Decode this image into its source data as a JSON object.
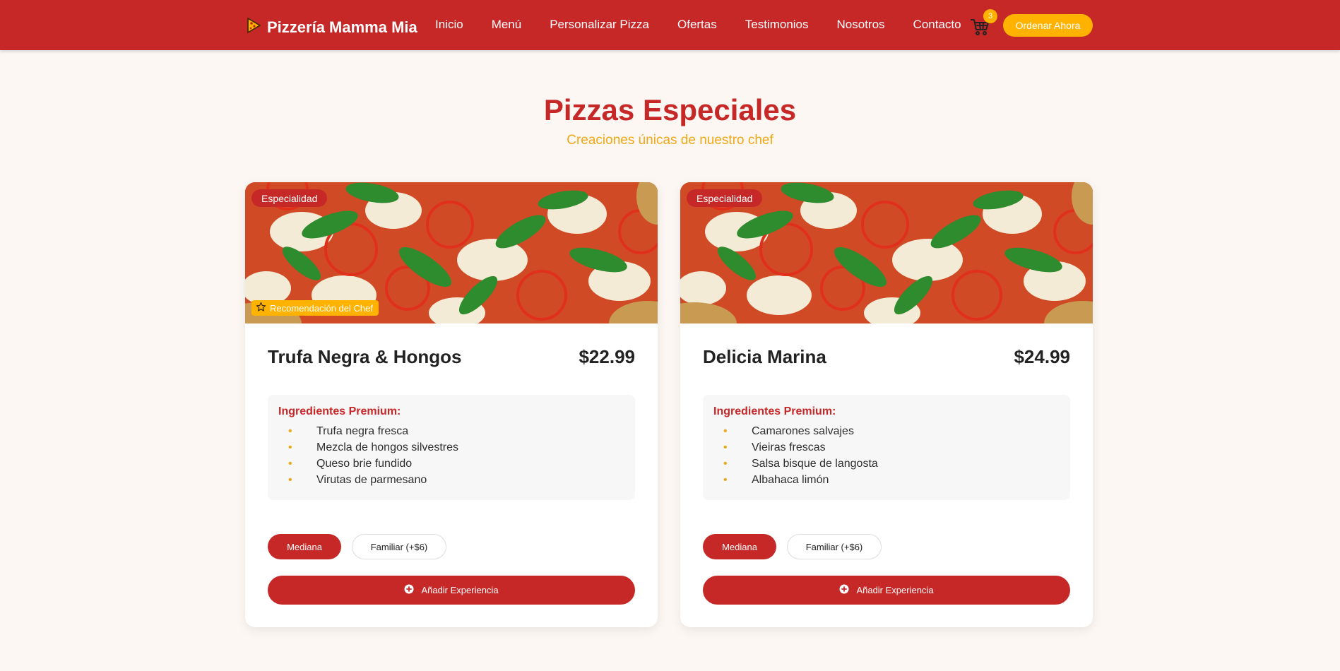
{
  "colors": {
    "primary": "#c62828",
    "accent": "#ffb300",
    "subtitle": "#f0a818",
    "background": "#fdf7f3"
  },
  "navbar": {
    "brand": "Pizzería Mamma Mia",
    "brand_icon": "pizza-slice-icon",
    "links": [
      "Inicio",
      "Menú",
      "Personalizar Pizza",
      "Ofertas",
      "Testimonios",
      "Nosotros",
      "Contacto"
    ],
    "cart_icon": "shopping-cart-icon",
    "cart_count": "3",
    "order_button": "Ordenar Ahora"
  },
  "section": {
    "title": "Pizzas Especiales",
    "subtitle": "Creaciones únicas de nuestro chef"
  },
  "cards": [
    {
      "badge": "Especialidad",
      "chef_badge": "Recomendación del Chef",
      "chef_icon": "star-icon",
      "name": "Trufa Negra & Hongos",
      "price": "$22.99",
      "ingredients_title": "Ingredientes Premium:",
      "ingredients": [
        "Trufa negra fresca",
        "Mezcla de hongos silvestres",
        "Queso brie fundido",
        "Virutas de parmesano"
      ],
      "sizes": [
        "Mediana",
        "Familiar (+$6)"
      ],
      "selected_size": "Mediana",
      "add_button": "Añadir Experiencia",
      "add_icon": "plus-circle-icon"
    },
    {
      "badge": "Especialidad",
      "name": "Delicia Marina",
      "price": "$24.99",
      "ingredients_title": "Ingredientes Premium:",
      "ingredients": [
        "Camarones salvajes",
        "Vieiras frescas",
        "Salsa bisque de langosta",
        "Albahaca limón"
      ],
      "sizes": [
        "Mediana",
        "Familiar (+$6)"
      ],
      "selected_size": "Mediana",
      "add_button": "Añadir Experiencia",
      "add_icon": "plus-circle-icon"
    }
  ]
}
